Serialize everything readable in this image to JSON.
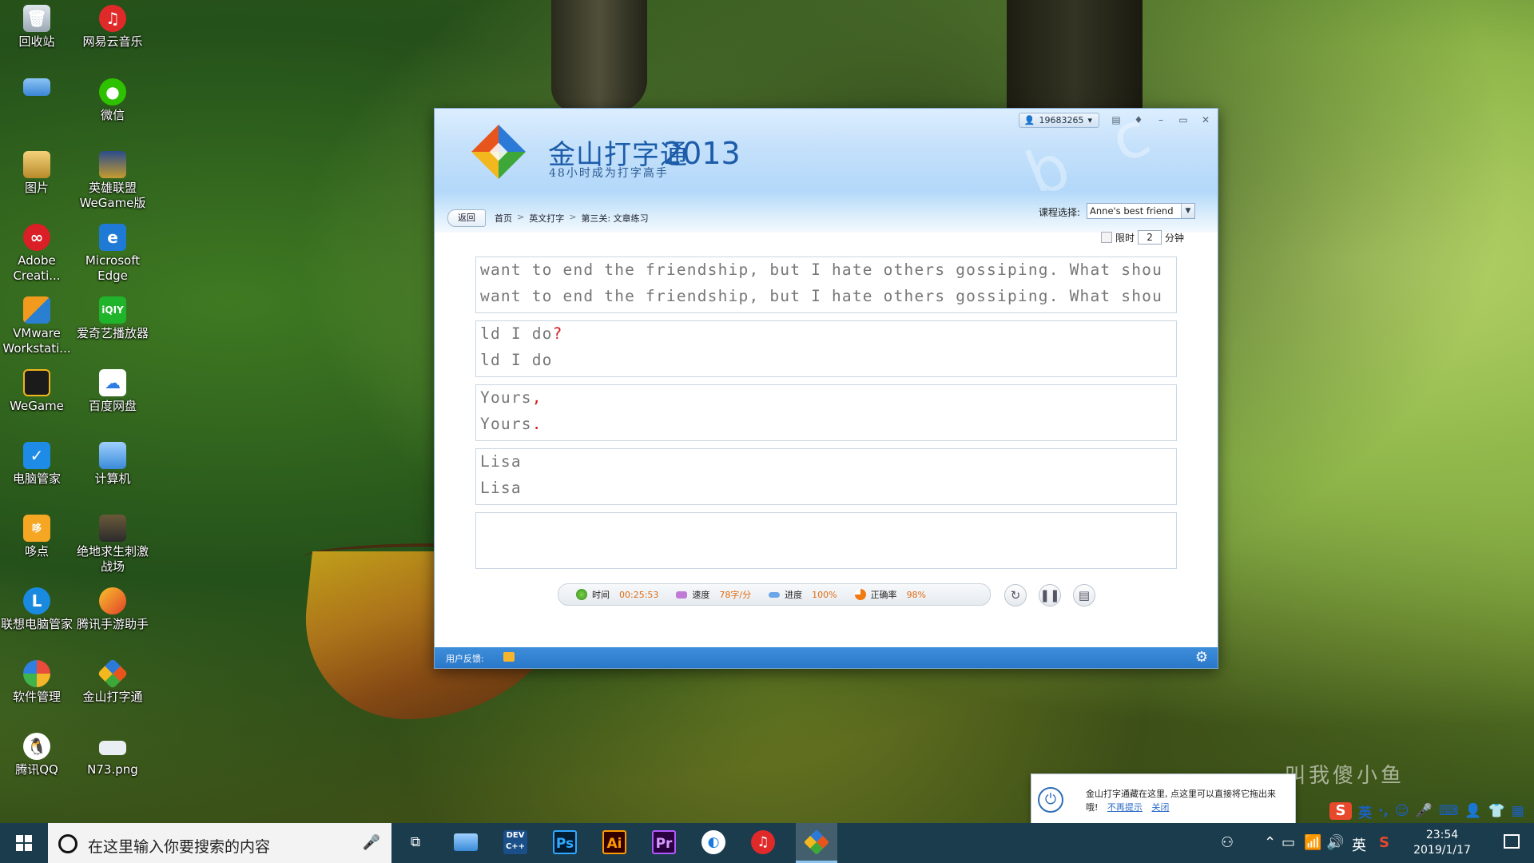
{
  "desktop": {
    "icons": [
      {
        "label": "回收站"
      },
      {
        "label": "网易云音乐"
      },
      {
        "label": ""
      },
      {
        "label": "微信"
      },
      {
        "label": "图片"
      },
      {
        "label": "英雄联盟 WeGame版"
      },
      {
        "label": "Adobe Creati..."
      },
      {
        "label": "Microsoft Edge"
      },
      {
        "label": "VMware Workstati..."
      },
      {
        "label": "爱奇艺播放器"
      },
      {
        "label": "WeGame"
      },
      {
        "label": "百度网盘"
      },
      {
        "label": "电脑管家"
      },
      {
        "label": "计算机"
      },
      {
        "label": "哆点"
      },
      {
        "label": "绝地求生刺激战场"
      },
      {
        "label": "联想电脑管家"
      },
      {
        "label": "腾讯手游助手"
      },
      {
        "label": "软件管理"
      },
      {
        "label": "金山打字通"
      },
      {
        "label": "腾讯QQ"
      },
      {
        "label": "N73.png"
      }
    ],
    "watermark": "叫我傻小鱼"
  },
  "app": {
    "title": "金山打字通",
    "year": "2013",
    "subtitle": "48小时成为打字高手",
    "user": "19683265",
    "back_label": "返回",
    "breadcrumb": [
      "首页",
      "英文打字",
      "第三关: 文章练习"
    ],
    "breadcrumb_sep": ">",
    "course_label": "课程选择:",
    "course_value": "Anne's best friend",
    "limit_label": "限时",
    "limit_value": "2",
    "limit_unit": "分钟",
    "lines": [
      {
        "ref": "want to end the friendship, but I hate others gossiping. What shou",
        "typed": "want to end the friendship, but I hate others gossiping. What shou",
        "ref_err": "",
        "typed_err": ""
      },
      {
        "ref": "ld I do",
        "ref_err": "?",
        "typed": "ld I do",
        "typed_err": ""
      },
      {
        "ref": "Yours",
        "ref_err": ",",
        "typed": "Yours",
        "typed_err": "."
      },
      {
        "ref": "Lisa",
        "ref_err": "",
        "typed": "Lisa",
        "typed_err": ""
      },
      {
        "ref": "",
        "ref_err": "",
        "typed": "",
        "typed_err": ""
      }
    ],
    "stats": {
      "time_label": "时间",
      "time_value": "00:25:53",
      "speed_label": "速度",
      "speed_value": "78字/分",
      "progress_label": "进度",
      "progress_value": "100%",
      "accuracy_label": "正确率",
      "accuracy_value": "98%"
    },
    "footer_label": "用户反馈:",
    "colors": {
      "accent": "#2a78c9",
      "value": "#e26b10",
      "error": "#d42020"
    }
  },
  "toast": {
    "message": "金山打字通藏在这里, 点这里可以直接将它拖出来哦!",
    "link_hide": "不再提示",
    "link_close": "关闭"
  },
  "taskbar": {
    "search_placeholder": "在这里输入你要搜索的内容",
    "ime_lang": "英",
    "ime_bar_lang": "英",
    "time": "23:54",
    "date": "2019/1/17"
  }
}
